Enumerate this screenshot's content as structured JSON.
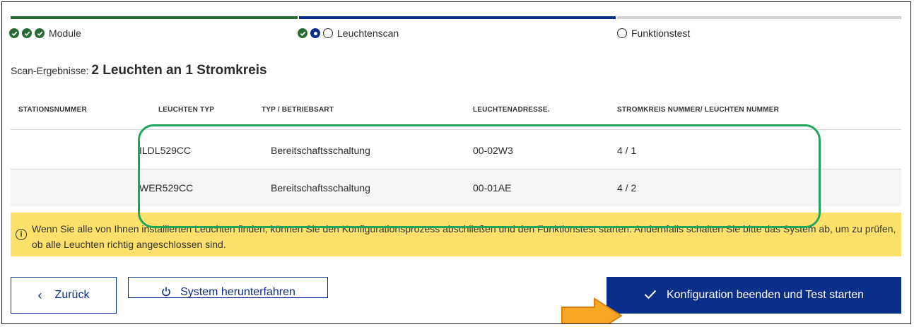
{
  "stepper": {
    "steps": [
      {
        "label": "Module",
        "state": "done"
      },
      {
        "label": "Leuchtenscan",
        "state": "active"
      },
      {
        "label": "Funktionstest",
        "state": "pending"
      }
    ]
  },
  "scan": {
    "prefix": "Scan-Ergebnisse:",
    "summary": "2 Leuchten an 1 Stromkreis"
  },
  "table": {
    "headers": [
      "STATIONSNUMMER",
      "LEUCHTEN TYP",
      "TYP / BETRIEBSART",
      "LEUCHTENADRESSE.",
      "STROMKREIS NUMMER/ LEUCHTEN NUMMER"
    ],
    "rows": [
      {
        "station": "",
        "type": "ILDL529CC",
        "mode": "Bereitschaftsschaltung",
        "address": "00-02W3",
        "circuit": "4 / 1"
      },
      {
        "station": "",
        "type": "WER529CC",
        "mode": "Bereitschaftsschaltung",
        "address": "00-01AE",
        "circuit": "4 / 2"
      }
    ]
  },
  "info": {
    "text": "Wenn Sie alle von Ihnen installierten Leuchten finden, können Sie den Konfigurationsprozess abschließen und den Funktionstest starten. Andernfalls schalten Sie bitte das System ab, um zu prüfen, ob alle Leuchten richtig angeschlossen sind."
  },
  "buttons": {
    "back": "Zurück",
    "shutdown": "System herunterfahren",
    "finish": "Konfiguration beenden und Test starten"
  },
  "colors": {
    "primary": "#0a2f8a",
    "success": "#2a6b35",
    "warning": "#fde16a",
    "highlight": "#1fa65a",
    "arrow": "#f5a623"
  },
  "icons": [
    "check-circle-icon",
    "radio-active-icon",
    "radio-empty-icon",
    "info-icon",
    "chevron-left-icon",
    "power-icon",
    "checkmark-icon",
    "arrow-right-icon"
  ]
}
